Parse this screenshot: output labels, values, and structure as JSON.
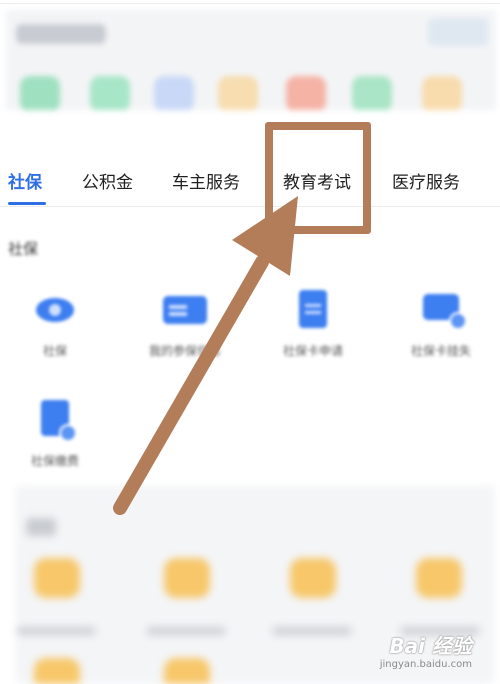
{
  "tabs": [
    {
      "label": "社保",
      "active": true
    },
    {
      "label": "公积金",
      "active": false
    },
    {
      "label": "车主服务",
      "active": false
    },
    {
      "label": "教育考试",
      "active": false
    },
    {
      "label": "医疗服务",
      "active": false
    }
  ],
  "section": {
    "title": "社保",
    "items": [
      {
        "label": "社保",
        "icon": "eye-icon"
      },
      {
        "label": "我的参保信息",
        "icon": "card-icon"
      },
      {
        "label": "社保卡申请",
        "icon": "document-icon"
      },
      {
        "label": "社保卡挂失",
        "icon": "card-search-icon"
      },
      {
        "label": "社保缴费",
        "icon": "document-search-icon"
      }
    ]
  },
  "annotation": {
    "highlighted_tab": "教育考试",
    "color": "#b47d5a"
  },
  "watermark": {
    "brand": "Bai 经验",
    "url": "jingyan.baidu.com"
  },
  "colors": {
    "accent": "#2f6fe4",
    "annotation": "#b47d5a"
  }
}
